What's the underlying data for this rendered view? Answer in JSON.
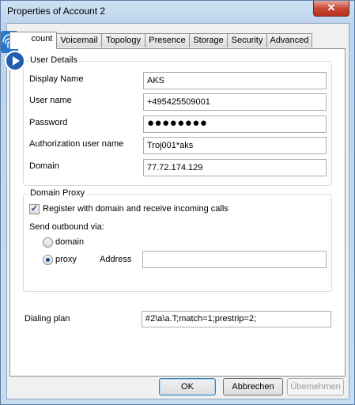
{
  "window": {
    "title": "Properties of Account 2",
    "close_symbol": "✕"
  },
  "tabs": [
    {
      "label": "Account",
      "visible_label": "count",
      "active": true
    },
    {
      "label": "Voicemail"
    },
    {
      "label": "Topology"
    },
    {
      "label": "Presence"
    },
    {
      "label": "Storage"
    },
    {
      "label": "Security"
    },
    {
      "label": "Advanced"
    }
  ],
  "user_details": {
    "title": "User Details",
    "display_name": {
      "label": "Display Name",
      "value": "AKS"
    },
    "user_name": {
      "label": "User name",
      "value": "+495425509001"
    },
    "password": {
      "label": "Password",
      "value": "●●●●●●●●"
    },
    "auth_user": {
      "label": "Authorization user name",
      "value": "Troj001*aks"
    },
    "domain": {
      "label": "Domain",
      "value": "77.72.174.129"
    }
  },
  "domain_proxy": {
    "title": "Domain Proxy",
    "register": {
      "label": "Register with domain and receive incoming calls",
      "checked": true,
      "check_mark": "✓"
    },
    "send_outbound_label": "Send outbound via:",
    "option_domain": "domain",
    "option_proxy": "proxy",
    "selected": "proxy",
    "address": {
      "label": "Address",
      "value": ""
    }
  },
  "dialing_plan": {
    "label": "Dialing plan",
    "value": "#2\\a\\a.T;match=1;prestrip=2;"
  },
  "buttons": {
    "ok": "OK",
    "cancel": "Abbrechen",
    "apply": "Übernehmen"
  },
  "colors": {
    "accent": "#1b4a82",
    "close": "#c94a36",
    "icon_blue": "#2a77c9"
  }
}
